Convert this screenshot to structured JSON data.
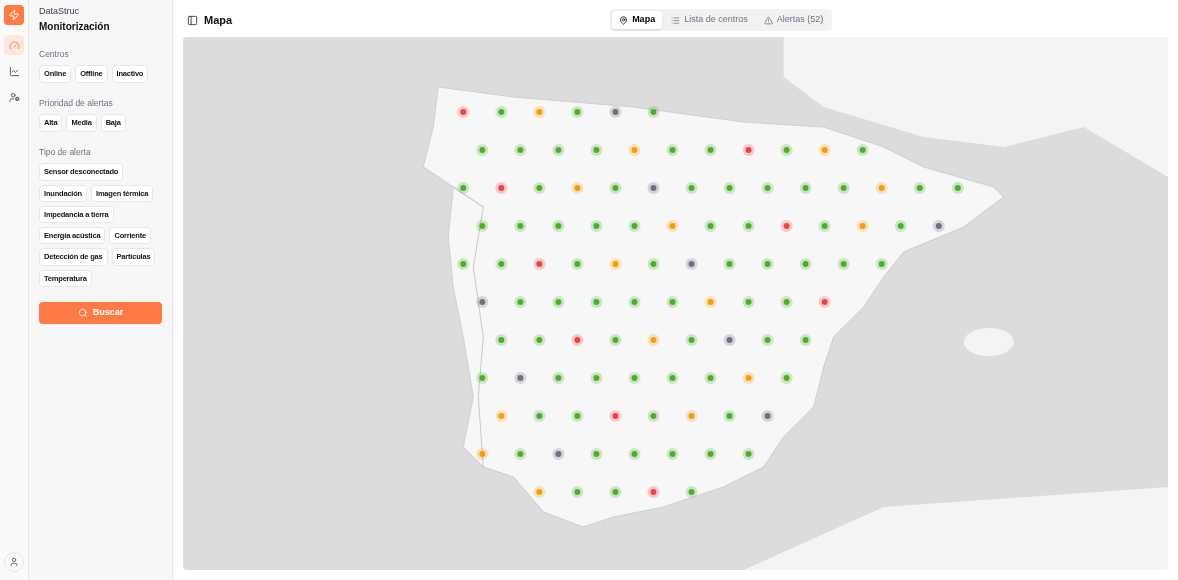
{
  "app": {
    "brand": "DataStruc",
    "title": "Monitorización"
  },
  "rail": [
    {
      "kind": "gauge",
      "selected": true
    },
    {
      "kind": "chart",
      "selected": false
    },
    {
      "kind": "users",
      "selected": false
    }
  ],
  "filters": [
    {
      "label": "Centros",
      "options": [
        "Online",
        "Offline",
        "Inactivo"
      ]
    },
    {
      "label": "Prioridad de alertas",
      "options": [
        "Alta",
        "Media",
        "Baja"
      ]
    },
    {
      "label": "Tipo de alerta",
      "options": [
        "Sensor desconectado",
        "Inundación",
        "Imagen térmica",
        "Impedancia a tierra",
        "Energía acústica",
        "Corriente",
        "Detección de gas",
        "Partículas",
        "Temperatura"
      ]
    }
  ],
  "search_button": "Buscar",
  "header": {
    "title": "Mapa"
  },
  "tabs": [
    {
      "label": "Mapa",
      "kind": "pin",
      "selected": true
    },
    {
      "label": "Lista de centros",
      "kind": "list",
      "selected": false
    },
    {
      "label": "Alertas (52)",
      "kind": "alert",
      "selected": false
    }
  ]
}
